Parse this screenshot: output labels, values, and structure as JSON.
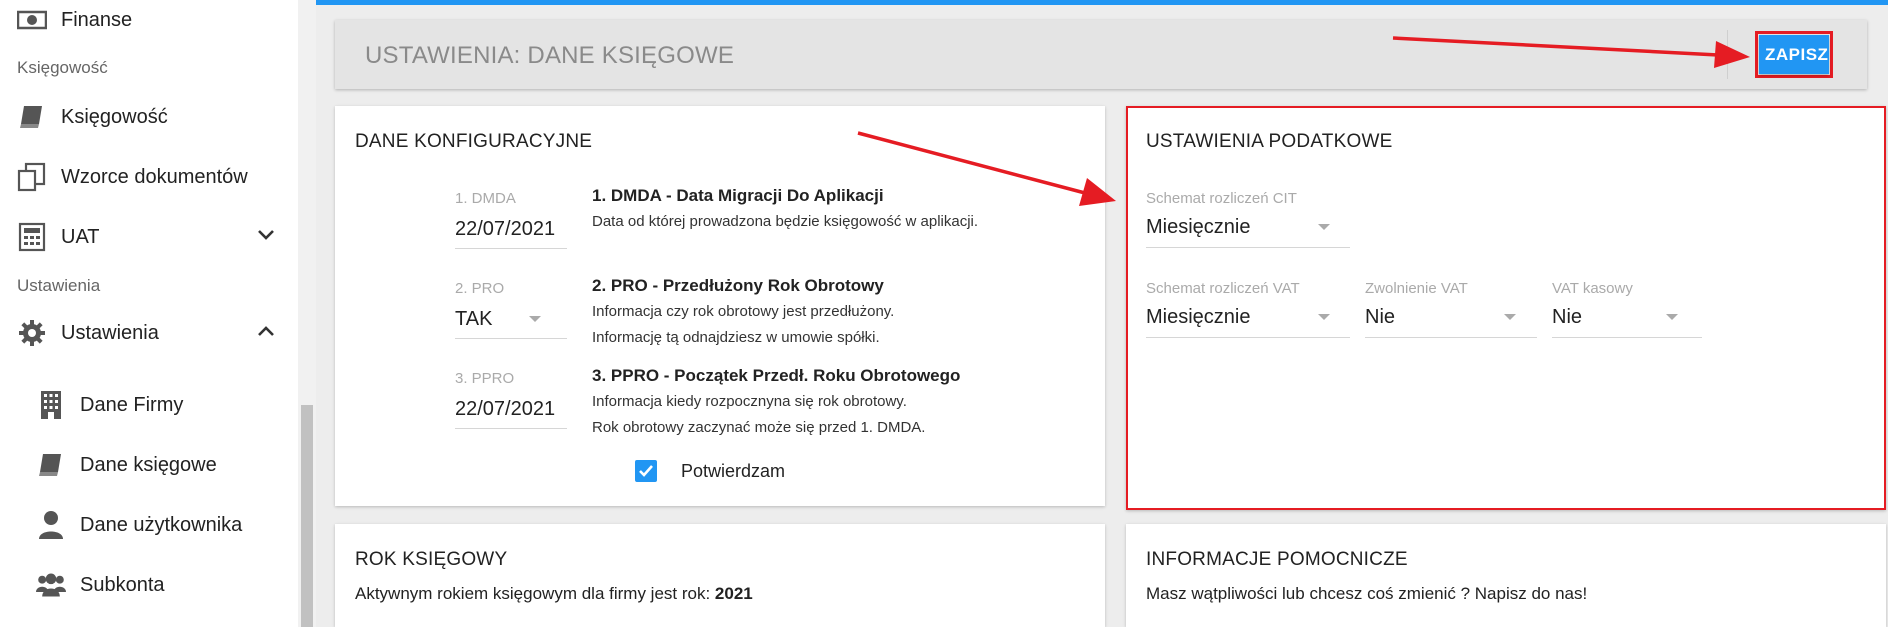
{
  "sidebar": {
    "top_item": {
      "label": "Finanse",
      "icon": "money-icon"
    },
    "section_accounting": "Księgowość",
    "items": [
      {
        "label": "Księgowość",
        "icon": "book-icon"
      },
      {
        "label": "Wzorce dokumentów",
        "icon": "documents-icon"
      },
      {
        "label": "UAT",
        "icon": "calculator-icon"
      }
    ],
    "section_settings": "Ustawienia",
    "settings_item": {
      "label": "Ustawienia",
      "icon": "gear-icon"
    },
    "sub_items": [
      {
        "label": "Dane Firmy",
        "icon": "building-icon"
      },
      {
        "label": "Dane księgowe",
        "icon": "book-icon"
      },
      {
        "label": "Dane użytkownika",
        "icon": "user-icon"
      },
      {
        "label": "Subkonta",
        "icon": "users-icon"
      }
    ]
  },
  "header": {
    "title": "USTAWIENIA: DANE KSIĘGOWE",
    "save_label": "ZAPISZ"
  },
  "config": {
    "title": "DANE KONFIGURACYJNE",
    "fields": [
      {
        "label": "1. DMDA",
        "value": "22/07/2021",
        "desc_title": "1. DMDA - Data Migracji Do Aplikacji",
        "desc_lines": [
          "Data od której prowadzona będzie księgowość w aplikacji."
        ]
      },
      {
        "label": "2. PRO",
        "value": "TAK",
        "desc_title": "2. PRO - Przedłużony Rok Obrotowy",
        "desc_lines": [
          "Informacja czy rok obrotowy jest przedłużony.",
          "Informację tą odnajdziesz w umowie spółki."
        ]
      },
      {
        "label": "3. PPRO",
        "value": "22/07/2021",
        "desc_title": "3. PPRO - Początek Przedł. Roku Obrotowego",
        "desc_lines": [
          "Informacja kiedy rozpocznyna się rok obrotowy.",
          "Rok obrotowy zaczynać może się przed 1. DMDA."
        ]
      }
    ],
    "confirm_label": "Potwierdzam",
    "confirm_checked": true
  },
  "tax": {
    "title": "USTAWIENIA PODATKOWE",
    "cit_label": "Schemat rozliczeń CIT",
    "cit_value": "Miesięcznie",
    "vat_label": "Schemat rozliczeń VAT",
    "vat_value": "Miesięcznie",
    "vat_exempt_label": "Zwolnienie VAT",
    "vat_exempt_value": "Nie",
    "vat_cash_label": "VAT kasowy",
    "vat_cash_value": "Nie"
  },
  "year": {
    "title": "ROK KSIĘGOWY",
    "text": "Aktywnym rokiem księgowym dla firmy jest rok:",
    "value": "2021"
  },
  "help": {
    "title": "INFORMACJE POMOCNICZE",
    "text": "Masz wątpliwości lub chcesz coś zmienić ? Napisz do nas!"
  },
  "colors": {
    "accent": "#2196f3",
    "annotation": "#e51c23"
  }
}
